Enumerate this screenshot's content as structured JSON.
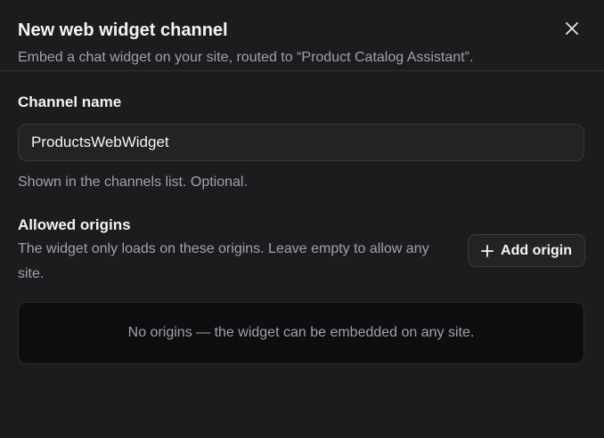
{
  "dialog": {
    "title": "New web widget channel",
    "subtitle": "Embed a chat widget on your site, routed to “Product Catalog Assistant”.",
    "close_icon": "close-icon"
  },
  "channel_name": {
    "label": "Channel name",
    "value": "ProductsWebWidget",
    "hint": "Shown in the channels list. Optional."
  },
  "allowed_origins": {
    "label": "Allowed origins",
    "description": "The widget only loads on these origins. Leave empty to allow any site.",
    "add_button_label": "Add origin",
    "add_icon": "plus-icon",
    "empty_message": "No origins — the widget can be embedded on any site."
  },
  "colors": {
    "background": "#1c1c1f",
    "input_background": "#232326",
    "empty_box_background": "#0e0e10",
    "text_primary": "#f4f4f5",
    "text_muted": "#a1a1a8"
  }
}
